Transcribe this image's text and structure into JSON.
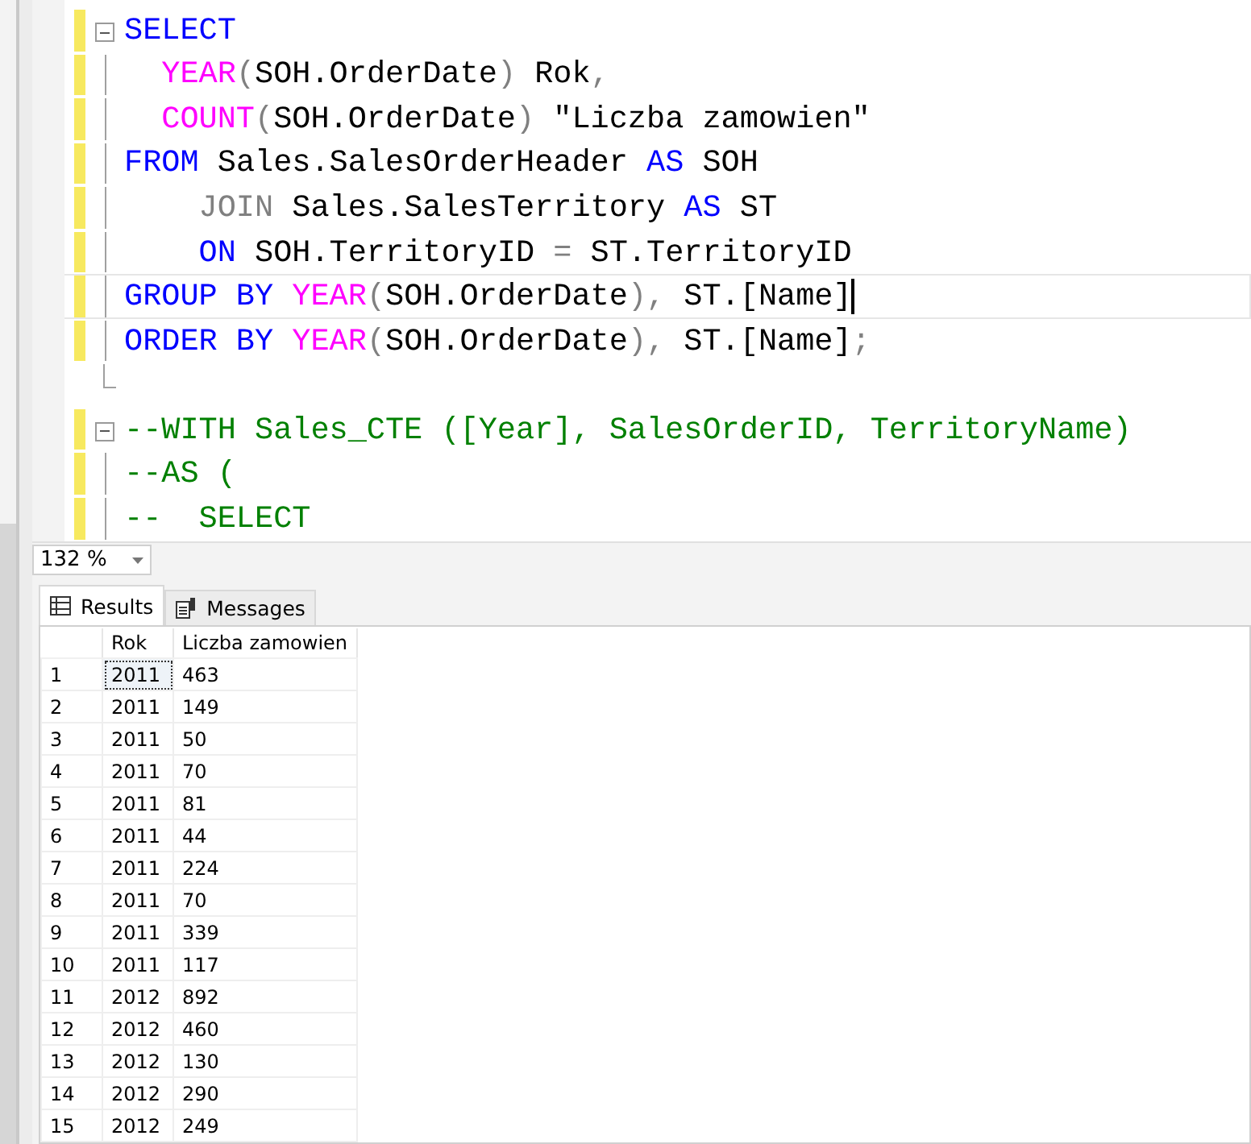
{
  "editor": {
    "lines": [
      {
        "kind": "fold-start",
        "changed": true,
        "current": false,
        "tokens": [
          {
            "kind": "keyword",
            "text": "SELECT"
          }
        ]
      },
      {
        "kind": "body",
        "changed": true,
        "current": false,
        "tokens": [
          {
            "kind": "function",
            "text": "  YEAR"
          },
          {
            "kind": "operator",
            "text": "("
          },
          {
            "kind": "plain",
            "text": "SOH.OrderDate"
          },
          {
            "kind": "operator",
            "text": ")"
          },
          {
            "kind": "plain",
            "text": " Rok"
          },
          {
            "kind": "operator",
            "text": ","
          }
        ]
      },
      {
        "kind": "body",
        "changed": true,
        "current": false,
        "tokens": [
          {
            "kind": "function",
            "text": "  COUNT"
          },
          {
            "kind": "operator",
            "text": "("
          },
          {
            "kind": "plain",
            "text": "SOH.OrderDate"
          },
          {
            "kind": "operator",
            "text": ")"
          },
          {
            "kind": "plain",
            "text": " \"Liczba zamowien\""
          }
        ]
      },
      {
        "kind": "body",
        "changed": true,
        "current": false,
        "tokens": [
          {
            "kind": "keyword",
            "text": "FROM"
          },
          {
            "kind": "plain",
            "text": " Sales.SalesOrderHeader "
          },
          {
            "kind": "keyword",
            "text": "AS"
          },
          {
            "kind": "plain",
            "text": " SOH"
          }
        ]
      },
      {
        "kind": "body",
        "changed": true,
        "current": false,
        "tokens": [
          {
            "kind": "operator",
            "text": "    JOIN"
          },
          {
            "kind": "plain",
            "text": " Sales.SalesTerritory "
          },
          {
            "kind": "keyword",
            "text": "AS"
          },
          {
            "kind": "plain",
            "text": " ST"
          }
        ]
      },
      {
        "kind": "body",
        "changed": true,
        "current": false,
        "tokens": [
          {
            "kind": "keyword",
            "text": "    ON"
          },
          {
            "kind": "plain",
            "text": " SOH.TerritoryID "
          },
          {
            "kind": "operator",
            "text": "="
          },
          {
            "kind": "plain",
            "text": " ST.TerritoryID"
          }
        ]
      },
      {
        "kind": "body",
        "changed": true,
        "current": true,
        "tokens": [
          {
            "kind": "keyword",
            "text": "GROUP BY "
          },
          {
            "kind": "function",
            "text": "YEAR"
          },
          {
            "kind": "operator",
            "text": "("
          },
          {
            "kind": "plain",
            "text": "SOH.OrderDate"
          },
          {
            "kind": "operator",
            "text": "),"
          },
          {
            "kind": "plain",
            "text": " ST.[Name]"
          }
        ]
      },
      {
        "kind": "body",
        "changed": true,
        "current": false,
        "tokens": [
          {
            "kind": "keyword",
            "text": "ORDER BY "
          },
          {
            "kind": "function",
            "text": "YEAR"
          },
          {
            "kind": "operator",
            "text": "("
          },
          {
            "kind": "plain",
            "text": "SOH.OrderDate"
          },
          {
            "kind": "operator",
            "text": "),"
          },
          {
            "kind": "plain",
            "text": " ST.[Name]"
          },
          {
            "kind": "operator",
            "text": ";"
          }
        ]
      },
      {
        "kind": "fold-end",
        "changed": false,
        "current": false
      },
      {
        "kind": "fold-start",
        "changed": true,
        "current": false,
        "tokens": [
          {
            "kind": "comment",
            "text": "--WITH Sales_CTE ([Year], SalesOrderID, TerritoryName)"
          }
        ]
      },
      {
        "kind": "body",
        "changed": true,
        "current": false,
        "tokens": [
          {
            "kind": "comment",
            "text": "--AS ("
          }
        ]
      },
      {
        "kind": "body",
        "changed": true,
        "current": false,
        "tokens": [
          {
            "kind": "comment",
            "text": "--  SELECT"
          }
        ]
      }
    ]
  },
  "zoom": {
    "value": "132 %"
  },
  "tabs": [
    {
      "label": "Results",
      "selected": true
    },
    {
      "label": "Messages",
      "selected": false
    }
  ],
  "results": {
    "columns": [
      "Rok",
      "Liczba zamowien"
    ],
    "rows": [
      {
        "number": "1",
        "cells": [
          {
            "text": "2011",
            "focused": true
          },
          {
            "text": "463",
            "focused": false
          }
        ]
      },
      {
        "number": "2",
        "cells": [
          {
            "text": "2011",
            "focused": false
          },
          {
            "text": "149",
            "focused": false
          }
        ]
      },
      {
        "number": "3",
        "cells": [
          {
            "text": "2011",
            "focused": false
          },
          {
            "text": "50",
            "focused": false
          }
        ]
      },
      {
        "number": "4",
        "cells": [
          {
            "text": "2011",
            "focused": false
          },
          {
            "text": "70",
            "focused": false
          }
        ]
      },
      {
        "number": "5",
        "cells": [
          {
            "text": "2011",
            "focused": false
          },
          {
            "text": "81",
            "focused": false
          }
        ]
      },
      {
        "number": "6",
        "cells": [
          {
            "text": "2011",
            "focused": false
          },
          {
            "text": "44",
            "focused": false
          }
        ]
      },
      {
        "number": "7",
        "cells": [
          {
            "text": "2011",
            "focused": false
          },
          {
            "text": "224",
            "focused": false
          }
        ]
      },
      {
        "number": "8",
        "cells": [
          {
            "text": "2011",
            "focused": false
          },
          {
            "text": "70",
            "focused": false
          }
        ]
      },
      {
        "number": "9",
        "cells": [
          {
            "text": "2011",
            "focused": false
          },
          {
            "text": "339",
            "focused": false
          }
        ]
      },
      {
        "number": "10",
        "cells": [
          {
            "text": "2011",
            "focused": false
          },
          {
            "text": "117",
            "focused": false
          }
        ]
      },
      {
        "number": "11",
        "cells": [
          {
            "text": "2012",
            "focused": false
          },
          {
            "text": "892",
            "focused": false
          }
        ]
      },
      {
        "number": "12",
        "cells": [
          {
            "text": "2012",
            "focused": false
          },
          {
            "text": "460",
            "focused": false
          }
        ]
      },
      {
        "number": "13",
        "cells": [
          {
            "text": "2012",
            "focused": false
          },
          {
            "text": "130",
            "focused": false
          }
        ]
      },
      {
        "number": "14",
        "cells": [
          {
            "text": "2012",
            "focused": false
          },
          {
            "text": "290",
            "focused": false
          }
        ]
      },
      {
        "number": "15",
        "cells": [
          {
            "text": "2012",
            "focused": false
          },
          {
            "text": "249",
            "focused": false
          }
        ]
      }
    ]
  }
}
